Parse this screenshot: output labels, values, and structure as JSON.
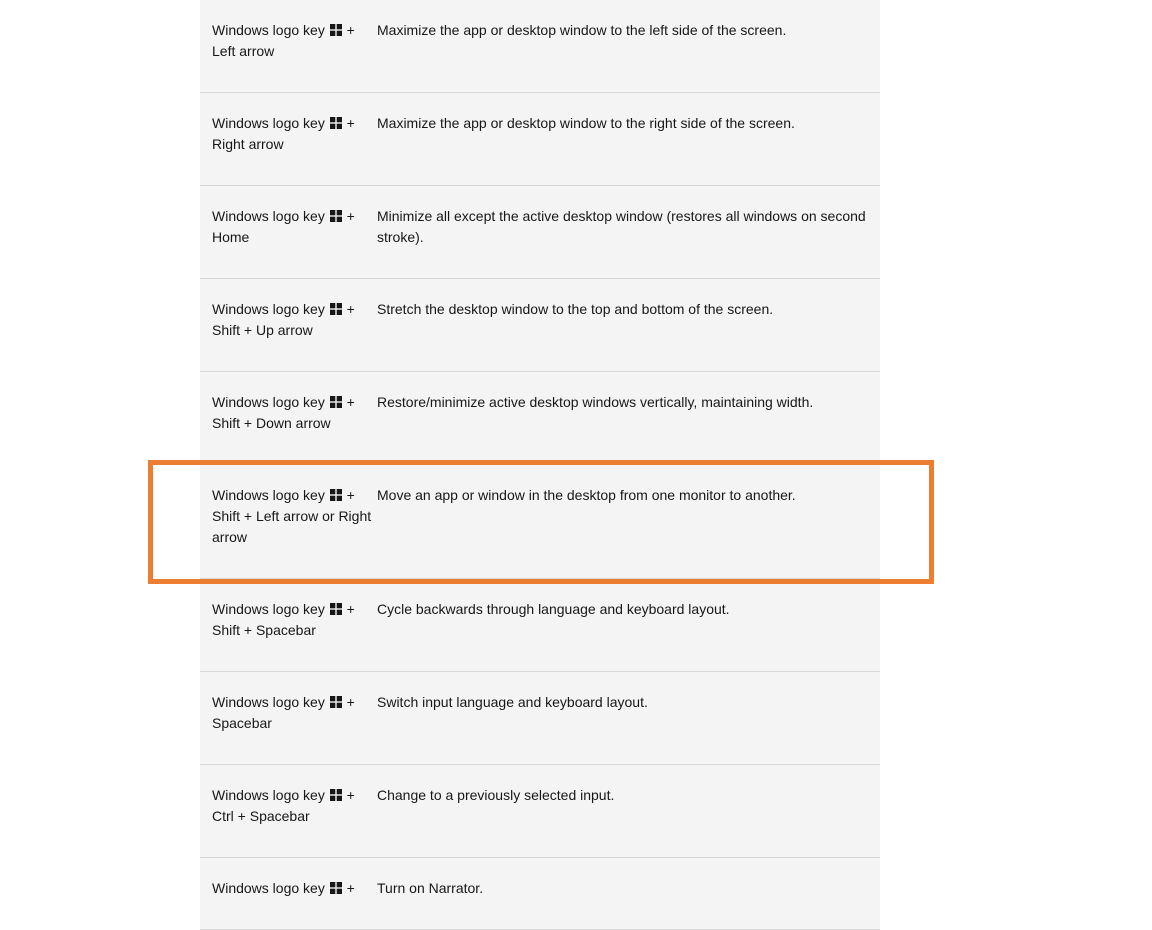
{
  "shortcuts": [
    {
      "pre": "Windows logo key ",
      "post": " + Left arrow",
      "desc": "Maximize the app or desktop window to the left side of the screen."
    },
    {
      "pre": "Windows logo key ",
      "post": " + Right arrow",
      "desc": "Maximize the app or desktop window to the right side of the screen."
    },
    {
      "pre": "Windows logo key ",
      "post": " + Home",
      "desc": "Minimize all except the active desktop window (restores all windows on second stroke)."
    },
    {
      "pre": "Windows logo key ",
      "post": " + Shift + Up arrow",
      "desc": "Stretch the desktop window to the top and bottom of the screen."
    },
    {
      "pre": "Windows logo key ",
      "post": " + Shift + Down arrow",
      "desc": "Restore/minimize active desktop windows vertically, maintaining width."
    },
    {
      "pre": "Windows logo key ",
      "post": " + Shift + Left arrow or Right arrow",
      "desc": "Move an app or window in the desktop from one monitor to another.",
      "highlighted": true
    },
    {
      "pre": "Windows logo key ",
      "post": " + Shift + Spacebar",
      "desc": "Cycle backwards through language and keyboard layout."
    },
    {
      "pre": "Windows logo key ",
      "post": " + Spacebar",
      "desc": "Switch input language and keyboard layout."
    },
    {
      "pre": "Windows logo key ",
      "post": " + Ctrl + Spacebar",
      "desc": "Change to a previously selected input."
    },
    {
      "pre": "Windows logo key ",
      "post": " + ",
      "desc": "Turn on Narrator."
    }
  ],
  "highlight_color": "#ed7d31"
}
